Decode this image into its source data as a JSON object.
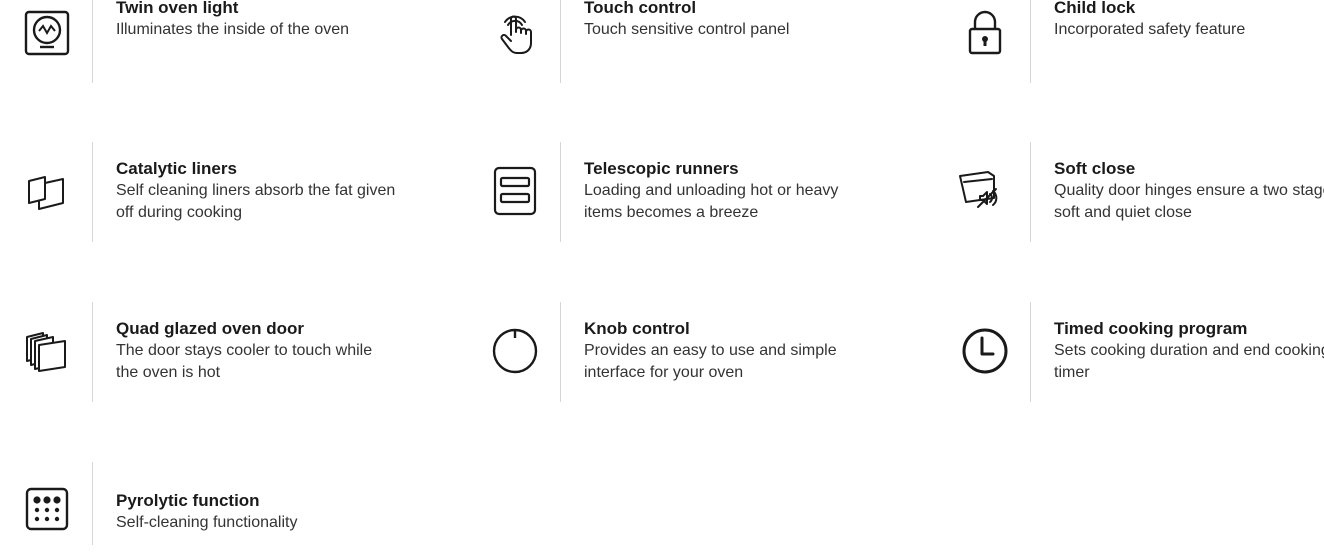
{
  "features": [
    {
      "title": "Twin oven light",
      "desc": "Illuminates the inside of the oven",
      "icon": "oven-light-icon"
    },
    {
      "title": "Touch control",
      "desc": "Touch sensitive control panel",
      "icon": "touch-control-icon"
    },
    {
      "title": "Child lock",
      "desc": "Incorporated safety feature",
      "icon": "padlock-icon"
    },
    {
      "title": "Catalytic liners",
      "desc": "Self cleaning liners absorb the fat given off during cooking",
      "icon": "catalytic-liners-icon"
    },
    {
      "title": "Telescopic runners",
      "desc": "Loading and unloading hot or heavy items becomes a breeze",
      "icon": "telescopic-runners-icon"
    },
    {
      "title": "Soft close",
      "desc": "Quality door hinges ensure a two stage soft and quiet close",
      "icon": "soft-close-icon"
    },
    {
      "title": "Quad glazed oven door",
      "desc": "The door stays cooler to touch while the oven is hot",
      "icon": "quad-glazed-door-icon"
    },
    {
      "title": "Knob control",
      "desc": "Provides an easy to use and simple interface for your oven",
      "icon": "knob-icon"
    },
    {
      "title": "Timed cooking program",
      "desc": "Sets cooking duration and end cooking timer",
      "icon": "clock-icon"
    },
    {
      "title": "Pyrolytic function",
      "desc": "Self-cleaning functionality",
      "icon": "pyrolytic-icon"
    }
  ],
  "colors": {
    "text": "#1a1a1a",
    "divider": "#d6d6d6"
  }
}
